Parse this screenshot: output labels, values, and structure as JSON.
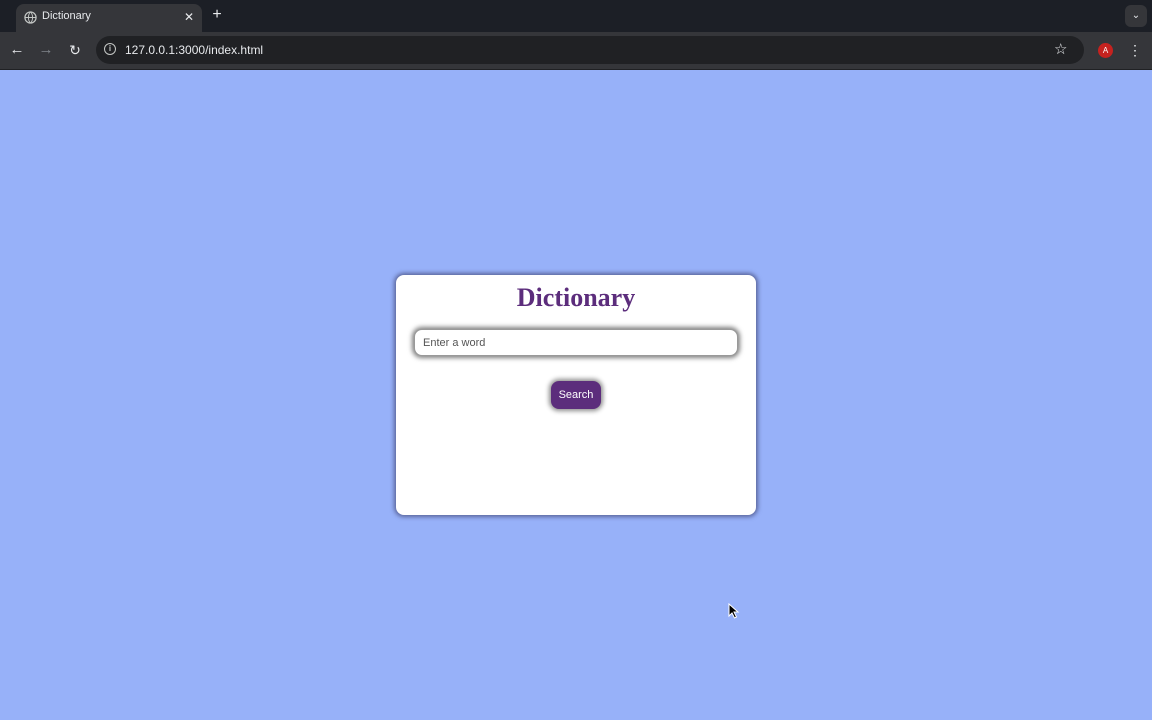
{
  "browser": {
    "tab": {
      "title": "Dictionary",
      "favicon_icon": "globe-icon",
      "close_icon": "close-icon"
    },
    "new_tab_icon": "plus-icon",
    "tab_search_icon": "chevron-down-icon",
    "toolbar": {
      "back_icon": "arrow-left-icon",
      "forward_icon": "arrow-right-icon",
      "reload_icon": "reload-icon",
      "site_info_icon": "info-icon",
      "url": "127.0.0.1:3000/index.html",
      "bookmark_icon": "star-icon",
      "profile_initial": "A",
      "menu_icon": "kebab-menu-icon"
    }
  },
  "page": {
    "background_color": "#97b1f9",
    "accent_color": "#5c2d7c",
    "title": "Dictionary",
    "input": {
      "placeholder": "Enter a word",
      "value": ""
    },
    "search_button_label": "Search"
  }
}
